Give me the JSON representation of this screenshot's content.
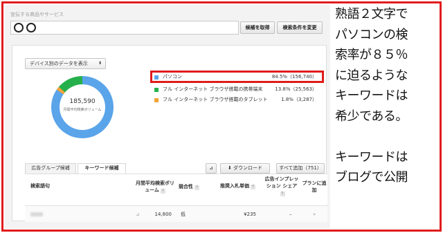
{
  "search": {
    "label": "宣伝する商品やサービス",
    "get_button": "候補を取得",
    "change_button": "検索条件を変更"
  },
  "device_panel": {
    "select_label": "デバイス別のデータを表示",
    "select_arrow": "⬍",
    "total": "185,590",
    "total_caption": "月間平均検索ボリューム"
  },
  "chart_data": {
    "type": "pie",
    "title": "",
    "total": 185590,
    "series": [
      {
        "label": "パソコン",
        "percent": 84.5,
        "value": 156740,
        "display": "84.5%（156,740）",
        "color": "#5aa4ea"
      },
      {
        "label": "フル インターネット ブラウザ搭載の携帯端末",
        "percent": 13.8,
        "value": 25563,
        "display": "13.8%（25,563）",
        "color": "#26b04c"
      },
      {
        "label": "フル インターネット ブラウザ搭載のタブレット",
        "percent": 1.8,
        "value": 3287,
        "display": "1.8%（3,287）",
        "color": "#f3a33a"
      }
    ]
  },
  "tabs": {
    "ad_group": "広告グループ候補",
    "keyword": "キーワード候補"
  },
  "toolbar": {
    "chart_icon": "chart-icon",
    "download": "⬇ ダウンロード",
    "add_all": "すべて追加（751）"
  },
  "table": {
    "headers": {
      "keyword": "検索語句",
      "volume": "月間平均検索ボリューム",
      "competition": "競合性",
      "bid": "推奨入札単価",
      "share": "広告インプレッション シェア",
      "plan": "プランに追加"
    },
    "rows": [
      {
        "volume": "14,800",
        "competition": "低",
        "bid": "¥235",
        "share": "–",
        "add": "»"
      }
    ]
  },
  "caption": {
    "lines": [
      "熟語２文字で",
      "パソコンの検",
      "索率が８５％",
      "に迫るような",
      "キーワードは",
      "希少である。",
      "",
      "キーワードは",
      "ブログで公開"
    ]
  },
  "colors": {
    "highlight": "#e01b1b",
    "desktop": "#5aa4ea",
    "mobile": "#26b04c",
    "tablet": "#f3a33a"
  }
}
